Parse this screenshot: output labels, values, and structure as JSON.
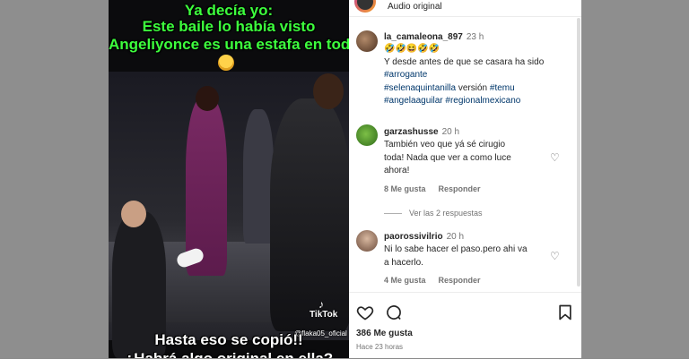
{
  "video": {
    "overlay_top_1": "Ya decía yo:",
    "overlay_top_2": "Este baile lo había visto",
    "overlay_top_3": "Angeliyonce  es una estafa en todo",
    "overlay_bottom_1": "Hasta eso se copió!!",
    "overlay_bottom_2": "¿Habrá algo original en ella?",
    "tiktok_brand": "TikTok",
    "tiktok_user": "@flaka05_oficial"
  },
  "header": {
    "audio_label": "Audio original"
  },
  "comments": [
    {
      "username": "la_camaleona_897",
      "time": "23 h",
      "emojis": "🤣🤣😆🤣🤣",
      "text": "Y desde antes de que se casara ha sido",
      "tags": [
        "#arrogante",
        "#selenaquintanilla",
        "versión",
        "#temu",
        "#angelaaguilar",
        "#regionalmexicano"
      ]
    },
    {
      "username": "garzashusse",
      "time": "20 h",
      "text_1": "También veo que yá sé cirugio",
      "text_2": "toda! Nada que ver a como luce",
      "text_3": "ahora!",
      "likes": "8 Me gusta",
      "reply": "Responder",
      "view_replies": "Ver las 2 respuestas"
    },
    {
      "username": "paorossivilrio",
      "time": "20 h",
      "text_1": "Ni lo sabe hacer el paso.pero ahi va",
      "text_2": "a hacerlo.",
      "likes": "4 Me gusta",
      "reply": "Responder"
    }
  ],
  "footer": {
    "likes": "386 Me gusta",
    "time_ago": "Hace 23 horas"
  },
  "icons": {
    "heart": "heart-icon",
    "comment": "comment-icon",
    "bookmark": "bookmark-icon"
  }
}
